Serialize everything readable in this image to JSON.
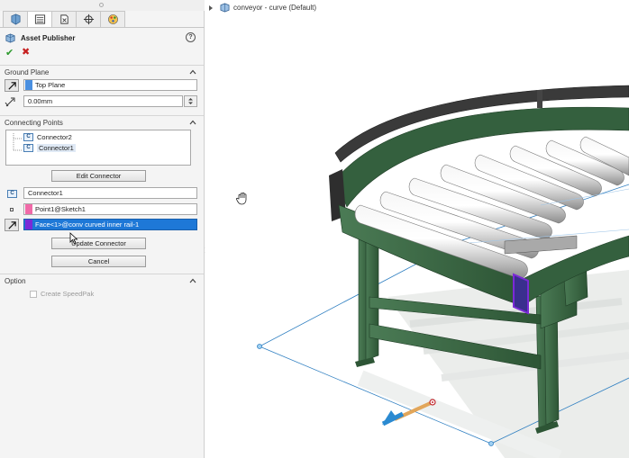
{
  "panel": {
    "title": "Asset Publisher",
    "help_label": "?",
    "ok_label": "✔",
    "cancel_label": "✖",
    "tabs": [
      {
        "icon": "feature-manager-icon"
      },
      {
        "icon": "property-manager-icon"
      },
      {
        "icon": "configuration-manager-icon"
      },
      {
        "icon": "dimxpert-icon"
      },
      {
        "icon": "display-manager-icon"
      }
    ]
  },
  "ground_plane": {
    "header": "Ground Plane",
    "plane_value": "Top Plane",
    "offset_value": "0.00mm"
  },
  "connecting_points": {
    "header": "Connecting Points",
    "items": [
      {
        "label": "Connector2",
        "icon_text": "C"
      },
      {
        "label": "Connector1",
        "icon_text": "C"
      }
    ],
    "edit_button": "Edit Connector",
    "connector_name": "Connector1",
    "point_value": "Point1@Sketch1",
    "face_value": "Face<1>@conv curved inner rail-1",
    "update_button": "Update Connector",
    "cancel_button": "Cancel"
  },
  "option": {
    "header": "Option",
    "speedpak_label": "Create SpeedPak",
    "speedpak_checked": false
  },
  "viewport": {
    "doc_title": "conveyor - curve  (Default)"
  },
  "colors": {
    "frame_green": "#3d6a47",
    "roller": "#dcdcdc",
    "selection_blue": "#1e78d7",
    "point_pink": "#f06aa8",
    "face_purple": "#7b2ad6",
    "plane_blue": "#2f7fc1"
  }
}
